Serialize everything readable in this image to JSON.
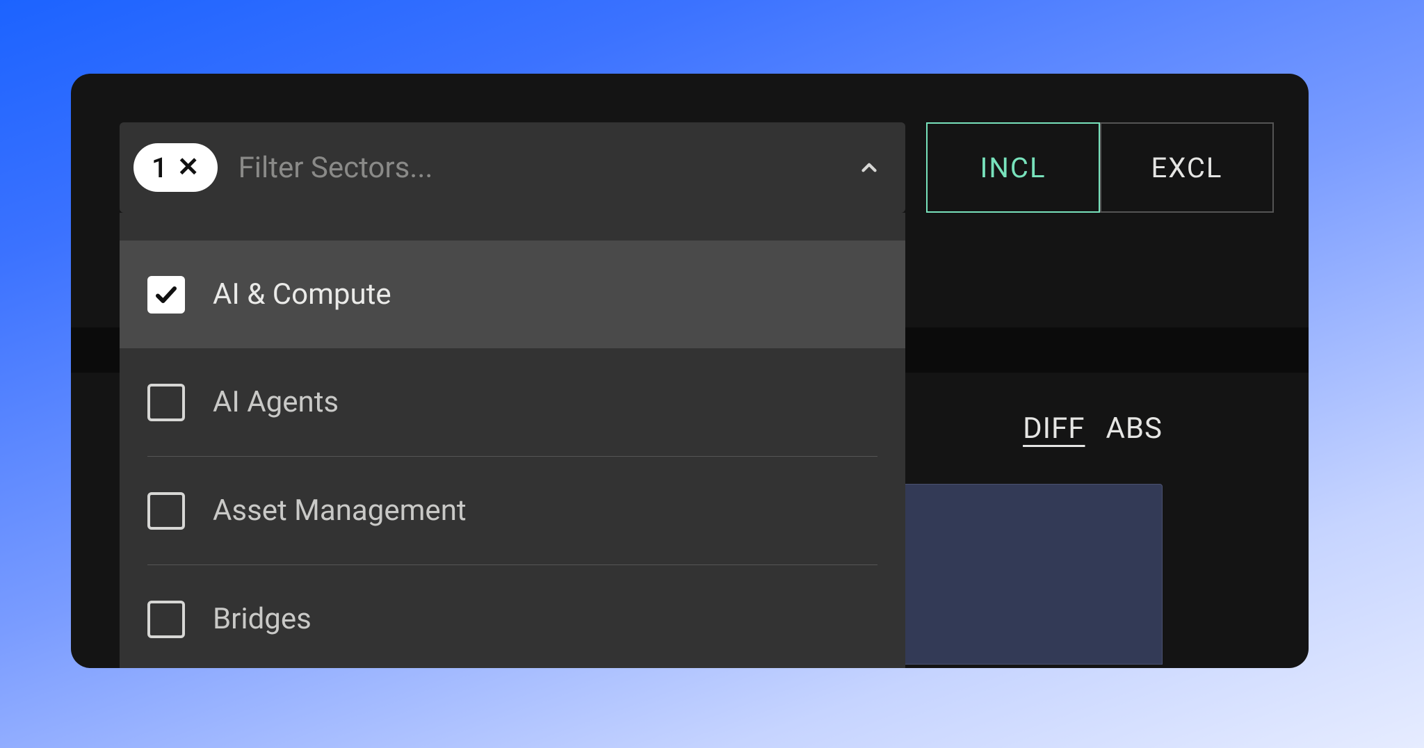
{
  "filter": {
    "chip_count": "1",
    "placeholder": "Filter Sectors..."
  },
  "toggle": {
    "include_label": "INCL",
    "exclude_label": "EXCL",
    "active": "include"
  },
  "mode": {
    "diff_label": "DIFF",
    "abs_label": "ABS",
    "active": "diff"
  },
  "sectors": [
    {
      "label": "AI & Compute",
      "checked": true
    },
    {
      "label": "AI Agents",
      "checked": false
    },
    {
      "label": "Asset Management",
      "checked": false
    },
    {
      "label": "Bridges",
      "checked": false
    }
  ],
  "colors": {
    "accent_green": "#78e2bc",
    "panel_bg": "#141414",
    "dropdown_bg": "#333333",
    "bar_fill": "#333a56"
  }
}
